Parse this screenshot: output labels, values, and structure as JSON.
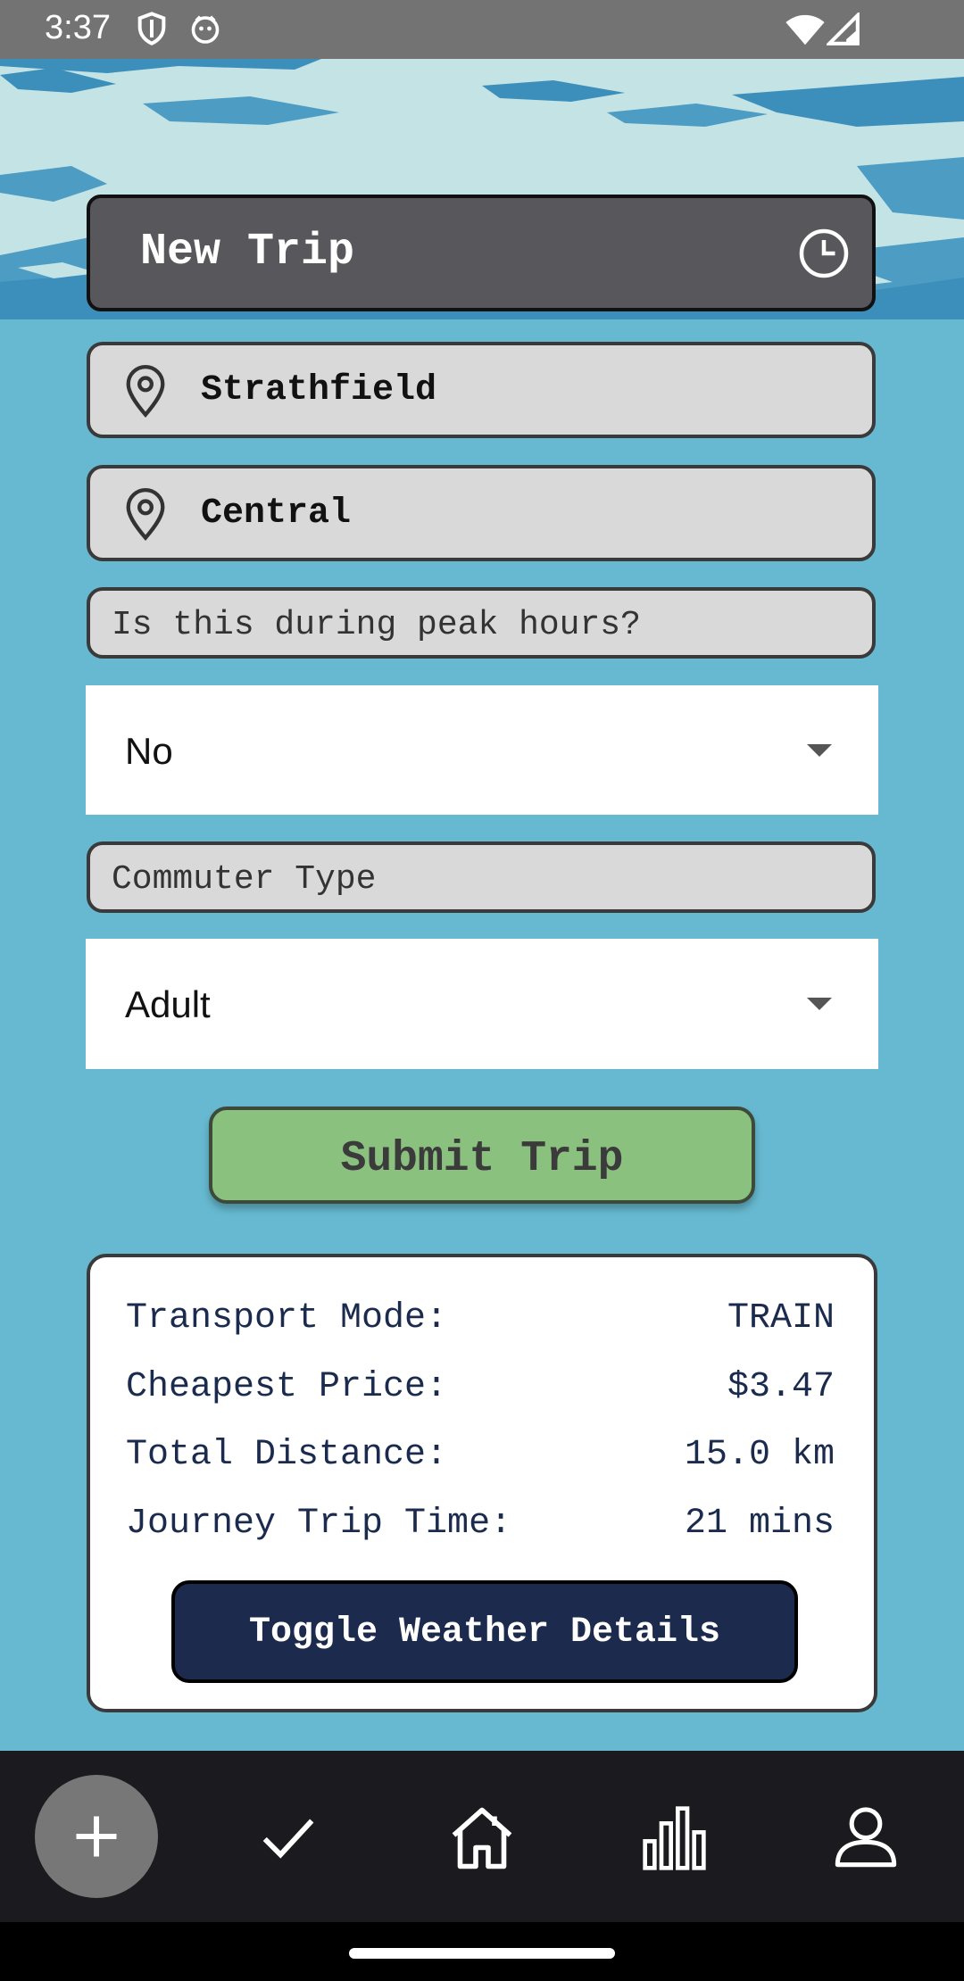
{
  "status_bar": {
    "time": "3:37"
  },
  "header": {
    "title": "New Trip"
  },
  "origin": {
    "value": "Strathfield"
  },
  "destination": {
    "value": "Central"
  },
  "peak": {
    "label": "Is this during peak hours?",
    "selected": "No"
  },
  "commuter": {
    "label": "Commuter Type",
    "selected": "Adult"
  },
  "submit": {
    "label": "Submit Trip"
  },
  "results": {
    "rows": [
      {
        "label": "Transport Mode:",
        "value": "TRAIN"
      },
      {
        "label": "Cheapest Price:",
        "value": "$3.47"
      },
      {
        "label": "Total Distance:",
        "value": "15.0 km"
      },
      {
        "label": "Journey Trip Time:",
        "value": "21 mins"
      }
    ],
    "weather_button": "Toggle Weather Details"
  },
  "nav": {
    "items": [
      {
        "icon": "plus-icon"
      },
      {
        "icon": "check-icon"
      },
      {
        "icon": "home-icon"
      },
      {
        "icon": "bar-chart-icon"
      },
      {
        "icon": "person-icon"
      }
    ]
  },
  "colors": {
    "background": "#66B9D0",
    "header": "#58585C",
    "submit": "#8BC17F",
    "weather_button": "#1C2A4E",
    "nav": "#1B1A1E"
  }
}
